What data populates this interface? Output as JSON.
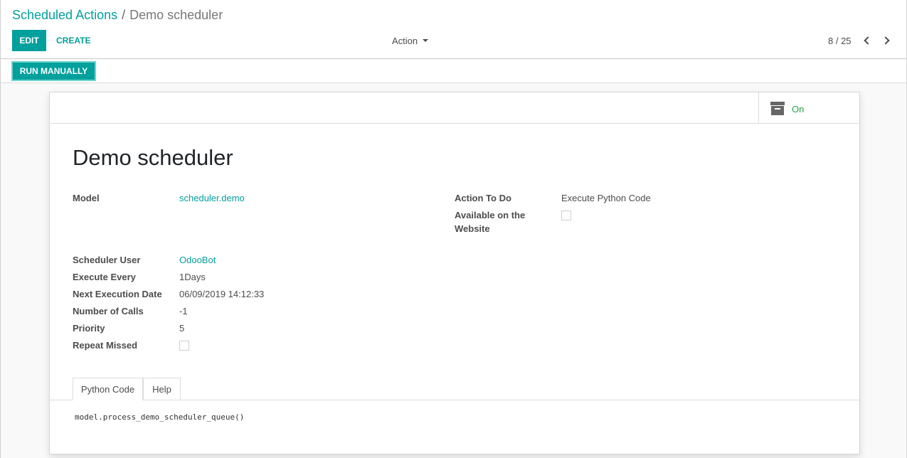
{
  "breadcrumb": {
    "parent": "Scheduled Actions",
    "separator": "/",
    "current": "Demo scheduler"
  },
  "toolbar": {
    "edit_label": "EDIT",
    "create_label": "CREATE",
    "action_label": "Action"
  },
  "pager": {
    "value": "8 / 25"
  },
  "statusbar": {
    "run_label": "RUN MANUALLY"
  },
  "sheet": {
    "active_label": "On",
    "title": "Demo scheduler",
    "fields": {
      "model": {
        "label": "Model",
        "value": "scheduler.demo"
      },
      "action_to_do": {
        "label": "Action To Do",
        "value": "Execute Python Code"
      },
      "available_website": {
        "label_line1": "Available on the",
        "label_line2": "Website",
        "checked": false
      },
      "scheduler_user": {
        "label": "Scheduler User",
        "value": "OdooBot"
      },
      "execute_every": {
        "label": "Execute Every",
        "value": "1Days"
      },
      "next_execution": {
        "label": "Next Execution Date",
        "value": "06/09/2019 14:12:33"
      },
      "number_of_calls": {
        "label": "Number of Calls",
        "value": "-1"
      },
      "priority": {
        "label": "Priority",
        "value": "5"
      },
      "repeat_missed": {
        "label": "Repeat Missed",
        "checked": false
      }
    },
    "tabs": [
      {
        "label": "Python Code",
        "active": true
      },
      {
        "label": "Help",
        "active": false
      }
    ],
    "code": "model.process_demo_scheduler_queue()"
  },
  "colors": {
    "accent": "#00a09d",
    "active_green": "#28a745"
  }
}
